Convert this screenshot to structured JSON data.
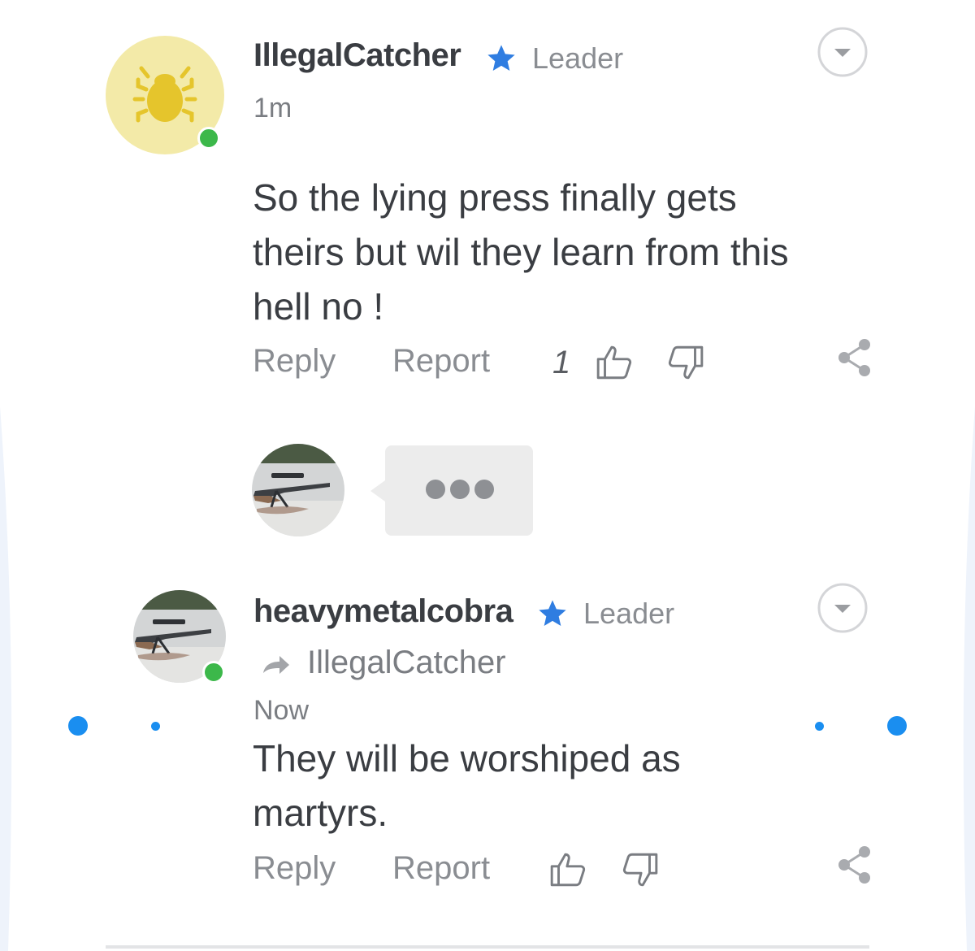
{
  "comments": [
    {
      "username": "IllegalCatcher",
      "rank": "Leader",
      "time": "1m",
      "body_lines": [
        "So the lying press finally gets",
        "theirs but wil they learn from this",
        "hell no !"
      ],
      "reply_label": "Reply",
      "report_label": "Report",
      "likes": "1",
      "avatar_icon": "bug-icon",
      "online": true
    },
    {
      "username": "heavymetalcobra",
      "rank": "Leader",
      "reply_to": "IllegalCatcher",
      "time": "Now",
      "body_lines": [
        "They will be worshiped as",
        "martyrs."
      ],
      "reply_label": "Reply",
      "report_label": "Report",
      "avatar_icon": "rifle-photo",
      "online": true
    }
  ],
  "typing_indicator": {
    "avatar_icon": "rifle-photo",
    "icon": "ellipsis-icon"
  },
  "colors": {
    "text": "#3a3d42",
    "muted": "#8a8d92",
    "star": "#2f7de1",
    "online": "#3cb84a",
    "selection": "#1a8ef0",
    "bug_bg": "#f3eaa8",
    "bug": "#e5c52c"
  }
}
